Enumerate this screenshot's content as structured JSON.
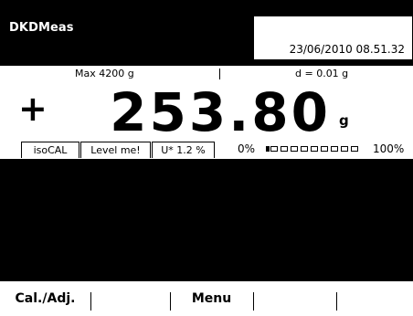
{
  "header": {
    "app_title": "DKDMeas",
    "datetime": "23/06/2010 08.51.32"
  },
  "info": {
    "max": "Max 4200 g",
    "d": "d = 0.01 g"
  },
  "reading": {
    "sign": "+",
    "value": "253.80",
    "unit": "g"
  },
  "status": {
    "tabs": [
      {
        "label": "isoCAL"
      },
      {
        "label": "Level me!"
      },
      {
        "label": "U* 1.2 %"
      }
    ],
    "range_min": "0%",
    "range_max": "100%",
    "range_fill_fraction": 0.06
  },
  "softkeys": [
    {
      "label": "Cal./Adj."
    },
    {
      "label": ""
    },
    {
      "label": "Menu"
    },
    {
      "label": ""
    },
    {
      "label": ""
    }
  ]
}
